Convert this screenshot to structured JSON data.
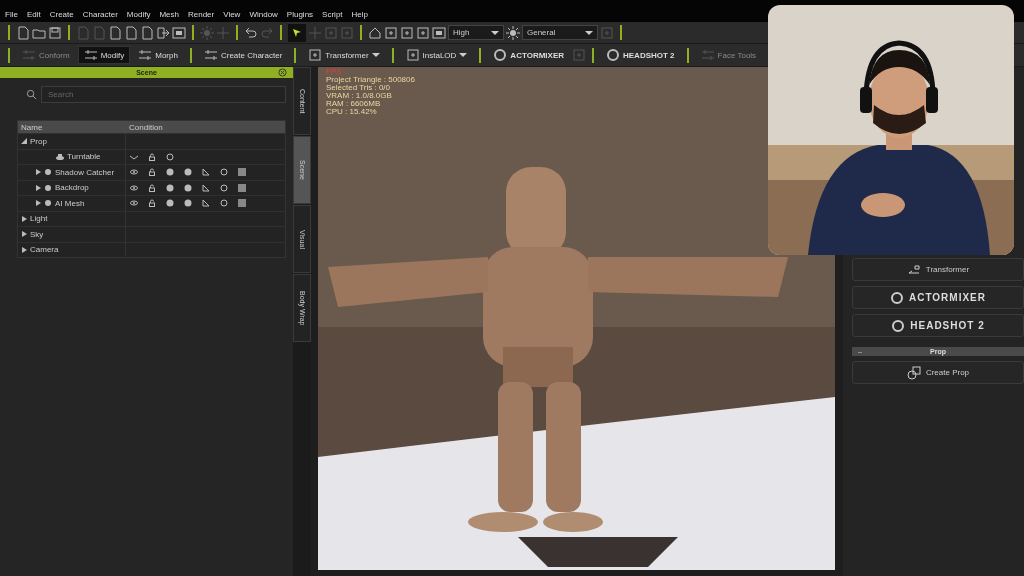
{
  "menu": [
    {
      "label": "File"
    },
    {
      "label": "Edit"
    },
    {
      "label": "Create"
    },
    {
      "label": "Character"
    },
    {
      "label": "Modify"
    },
    {
      "label": "Mesh"
    },
    {
      "label": "Render"
    },
    {
      "label": "View"
    },
    {
      "label": "Window"
    },
    {
      "label": "Plugins"
    },
    {
      "label": "Script"
    },
    {
      "label": "Help"
    }
  ],
  "toolbar_top": {
    "dropdowns": [
      {
        "value": "High"
      },
      {
        "value": "General"
      }
    ]
  },
  "toolbar_bottom": [
    {
      "label": "Conform",
      "kind": "button",
      "disabled": true,
      "selected": false
    },
    {
      "label": "Modify",
      "kind": "button",
      "disabled": false,
      "selected": true
    },
    {
      "label": "Morph",
      "kind": "button",
      "disabled": false,
      "selected": false
    },
    {
      "label": "Create Character",
      "kind": "button",
      "disabled": false,
      "selected": false
    },
    {
      "label": "Transformer",
      "kind": "menu",
      "disabled": false,
      "selected": false
    },
    {
      "label": "InstaLOD",
      "kind": "menu",
      "disabled": false,
      "selected": false
    },
    {
      "label": "ACTORMIXER",
      "kind": "logo",
      "disabled": false,
      "selected": false
    },
    {
      "label": "HEADSHOT 2",
      "kind": "logo",
      "disabled": false,
      "selected": false
    },
    {
      "label": "Face Tools",
      "kind": "button",
      "disabled": true,
      "selected": false
    }
  ],
  "scene_panel": {
    "title": "Scene",
    "search": {
      "placeholder": "Search"
    },
    "columns": [
      "Name",
      "Condition"
    ],
    "tree": [
      {
        "label": "Prop",
        "expanded": true,
        "children": [
          {
            "label": "Turntable",
            "kind": "turntable"
          },
          {
            "label": "Shadow Catcher",
            "kind": "object",
            "expanded": false
          },
          {
            "label": "Backdrop",
            "kind": "object",
            "expanded": false
          },
          {
            "label": "AI Mesh",
            "kind": "object",
            "expanded": false
          }
        ]
      },
      {
        "label": "Light",
        "expanded": false
      },
      {
        "label": "Sky",
        "expanded": false
      },
      {
        "label": "Camera",
        "expanded": false
      }
    ]
  },
  "side_tabs": [
    {
      "label": "Content",
      "selected": false
    },
    {
      "label": "Scene",
      "selected": true
    },
    {
      "label": "Visual",
      "selected": false
    },
    {
      "label": "Body Wrap",
      "selected": false
    }
  ],
  "viewport": {
    "stats": [
      {
        "text": "FPS :",
        "kind": "fps"
      },
      {
        "text": "Project Triangle : 500806",
        "kind": "stat"
      },
      {
        "text": "Selected Tris : 0/0",
        "kind": "stat"
      },
      {
        "text": "VRAM : 1.0/8.0GB",
        "kind": "stat"
      },
      {
        "text": "RAM : 6606MB",
        "kind": "stat"
      },
      {
        "text": "CPU : 15.42%",
        "kind": "stat"
      }
    ]
  },
  "right_panel": {
    "buttons": [
      {
        "label": "Transformer",
        "kind": "plain"
      },
      {
        "label": "ACTORMIXER",
        "kind": "logo"
      },
      {
        "label": "HEADSHOT 2",
        "kind": "logo"
      }
    ],
    "section": {
      "title": "Prop",
      "toggle": "–"
    },
    "section_buttons": [
      {
        "label": "Create Prop"
      }
    ]
  }
}
